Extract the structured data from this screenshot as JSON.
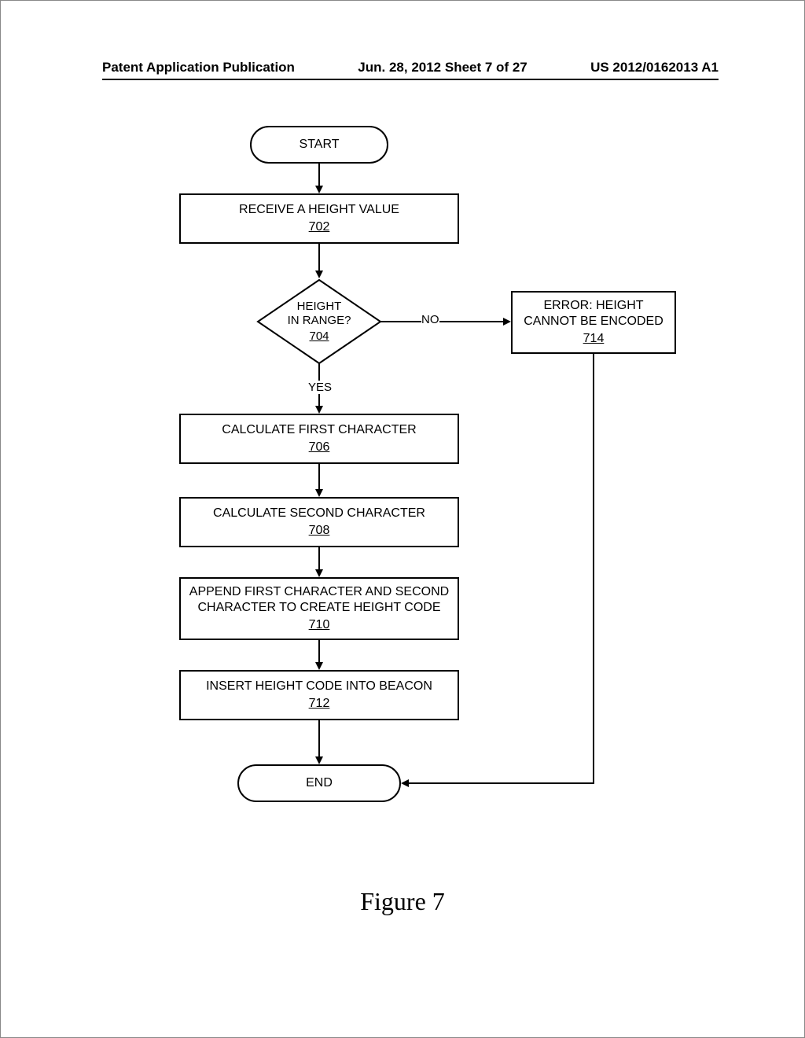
{
  "header": {
    "left": "Patent Application Publication",
    "center": "Jun. 28, 2012  Sheet 7 of 27",
    "right": "US 2012/0162013 A1"
  },
  "flow": {
    "start": "START",
    "end": "END",
    "n702": {
      "text": "RECEIVE A HEIGHT VALUE",
      "ref": "702"
    },
    "n704": {
      "l1": "HEIGHT",
      "l2": "IN RANGE?",
      "ref": "704"
    },
    "n706": {
      "text": "CALCULATE FIRST CHARACTER",
      "ref": "706"
    },
    "n708": {
      "text": "CALCULATE SECOND CHARACTER",
      "ref": "708"
    },
    "n710": {
      "l1": "APPEND FIRST CHARACTER AND SECOND",
      "l2": "CHARACTER TO CREATE HEIGHT CODE",
      "ref": "710"
    },
    "n712": {
      "text": "INSERT HEIGHT CODE INTO BEACON",
      "ref": "712"
    },
    "n714": {
      "l1": "ERROR: HEIGHT",
      "l2": "CANNOT BE ENCODED",
      "ref": "714"
    },
    "labels": {
      "yes": "YES",
      "no": "NO"
    }
  },
  "caption": "Figure 7"
}
